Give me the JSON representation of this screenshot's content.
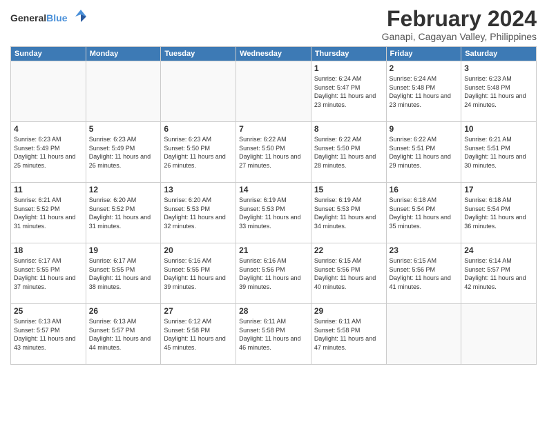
{
  "header": {
    "logo_general": "General",
    "logo_blue": "Blue",
    "month_title": "February 2024",
    "subtitle": "Ganapi, Cagayan Valley, Philippines"
  },
  "weekdays": [
    "Sunday",
    "Monday",
    "Tuesday",
    "Wednesday",
    "Thursday",
    "Friday",
    "Saturday"
  ],
  "weeks": [
    [
      {
        "day": "",
        "sunrise": "",
        "sunset": "",
        "daylight": "",
        "empty": true
      },
      {
        "day": "",
        "sunrise": "",
        "sunset": "",
        "daylight": "",
        "empty": true
      },
      {
        "day": "",
        "sunrise": "",
        "sunset": "",
        "daylight": "",
        "empty": true
      },
      {
        "day": "",
        "sunrise": "",
        "sunset": "",
        "daylight": "",
        "empty": true
      },
      {
        "day": "1",
        "sunrise": "6:24 AM",
        "sunset": "5:47 PM",
        "daylight": "11 hours and 23 minutes."
      },
      {
        "day": "2",
        "sunrise": "6:24 AM",
        "sunset": "5:48 PM",
        "daylight": "11 hours and 23 minutes."
      },
      {
        "day": "3",
        "sunrise": "6:23 AM",
        "sunset": "5:48 PM",
        "daylight": "11 hours and 24 minutes."
      }
    ],
    [
      {
        "day": "4",
        "sunrise": "6:23 AM",
        "sunset": "5:49 PM",
        "daylight": "11 hours and 25 minutes."
      },
      {
        "day": "5",
        "sunrise": "6:23 AM",
        "sunset": "5:49 PM",
        "daylight": "11 hours and 26 minutes."
      },
      {
        "day": "6",
        "sunrise": "6:23 AM",
        "sunset": "5:50 PM",
        "daylight": "11 hours and 26 minutes."
      },
      {
        "day": "7",
        "sunrise": "6:22 AM",
        "sunset": "5:50 PM",
        "daylight": "11 hours and 27 minutes."
      },
      {
        "day": "8",
        "sunrise": "6:22 AM",
        "sunset": "5:50 PM",
        "daylight": "11 hours and 28 minutes."
      },
      {
        "day": "9",
        "sunrise": "6:22 AM",
        "sunset": "5:51 PM",
        "daylight": "11 hours and 29 minutes."
      },
      {
        "day": "10",
        "sunrise": "6:21 AM",
        "sunset": "5:51 PM",
        "daylight": "11 hours and 30 minutes."
      }
    ],
    [
      {
        "day": "11",
        "sunrise": "6:21 AM",
        "sunset": "5:52 PM",
        "daylight": "11 hours and 31 minutes."
      },
      {
        "day": "12",
        "sunrise": "6:20 AM",
        "sunset": "5:52 PM",
        "daylight": "11 hours and 31 minutes."
      },
      {
        "day": "13",
        "sunrise": "6:20 AM",
        "sunset": "5:53 PM",
        "daylight": "11 hours and 32 minutes."
      },
      {
        "day": "14",
        "sunrise": "6:19 AM",
        "sunset": "5:53 PM",
        "daylight": "11 hours and 33 minutes."
      },
      {
        "day": "15",
        "sunrise": "6:19 AM",
        "sunset": "5:53 PM",
        "daylight": "11 hours and 34 minutes."
      },
      {
        "day": "16",
        "sunrise": "6:18 AM",
        "sunset": "5:54 PM",
        "daylight": "11 hours and 35 minutes."
      },
      {
        "day": "17",
        "sunrise": "6:18 AM",
        "sunset": "5:54 PM",
        "daylight": "11 hours and 36 minutes."
      }
    ],
    [
      {
        "day": "18",
        "sunrise": "6:17 AM",
        "sunset": "5:55 PM",
        "daylight": "11 hours and 37 minutes."
      },
      {
        "day": "19",
        "sunrise": "6:17 AM",
        "sunset": "5:55 PM",
        "daylight": "11 hours and 38 minutes."
      },
      {
        "day": "20",
        "sunrise": "6:16 AM",
        "sunset": "5:55 PM",
        "daylight": "11 hours and 39 minutes."
      },
      {
        "day": "21",
        "sunrise": "6:16 AM",
        "sunset": "5:56 PM",
        "daylight": "11 hours and 39 minutes."
      },
      {
        "day": "22",
        "sunrise": "6:15 AM",
        "sunset": "5:56 PM",
        "daylight": "11 hours and 40 minutes."
      },
      {
        "day": "23",
        "sunrise": "6:15 AM",
        "sunset": "5:56 PM",
        "daylight": "11 hours and 41 minutes."
      },
      {
        "day": "24",
        "sunrise": "6:14 AM",
        "sunset": "5:57 PM",
        "daylight": "11 hours and 42 minutes."
      }
    ],
    [
      {
        "day": "25",
        "sunrise": "6:13 AM",
        "sunset": "5:57 PM",
        "daylight": "11 hours and 43 minutes."
      },
      {
        "day": "26",
        "sunrise": "6:13 AM",
        "sunset": "5:57 PM",
        "daylight": "11 hours and 44 minutes."
      },
      {
        "day": "27",
        "sunrise": "6:12 AM",
        "sunset": "5:58 PM",
        "daylight": "11 hours and 45 minutes."
      },
      {
        "day": "28",
        "sunrise": "6:11 AM",
        "sunset": "5:58 PM",
        "daylight": "11 hours and 46 minutes."
      },
      {
        "day": "29",
        "sunrise": "6:11 AM",
        "sunset": "5:58 PM",
        "daylight": "11 hours and 47 minutes."
      },
      {
        "day": "",
        "sunrise": "",
        "sunset": "",
        "daylight": "",
        "empty": true
      },
      {
        "day": "",
        "sunrise": "",
        "sunset": "",
        "daylight": "",
        "empty": true
      }
    ]
  ]
}
